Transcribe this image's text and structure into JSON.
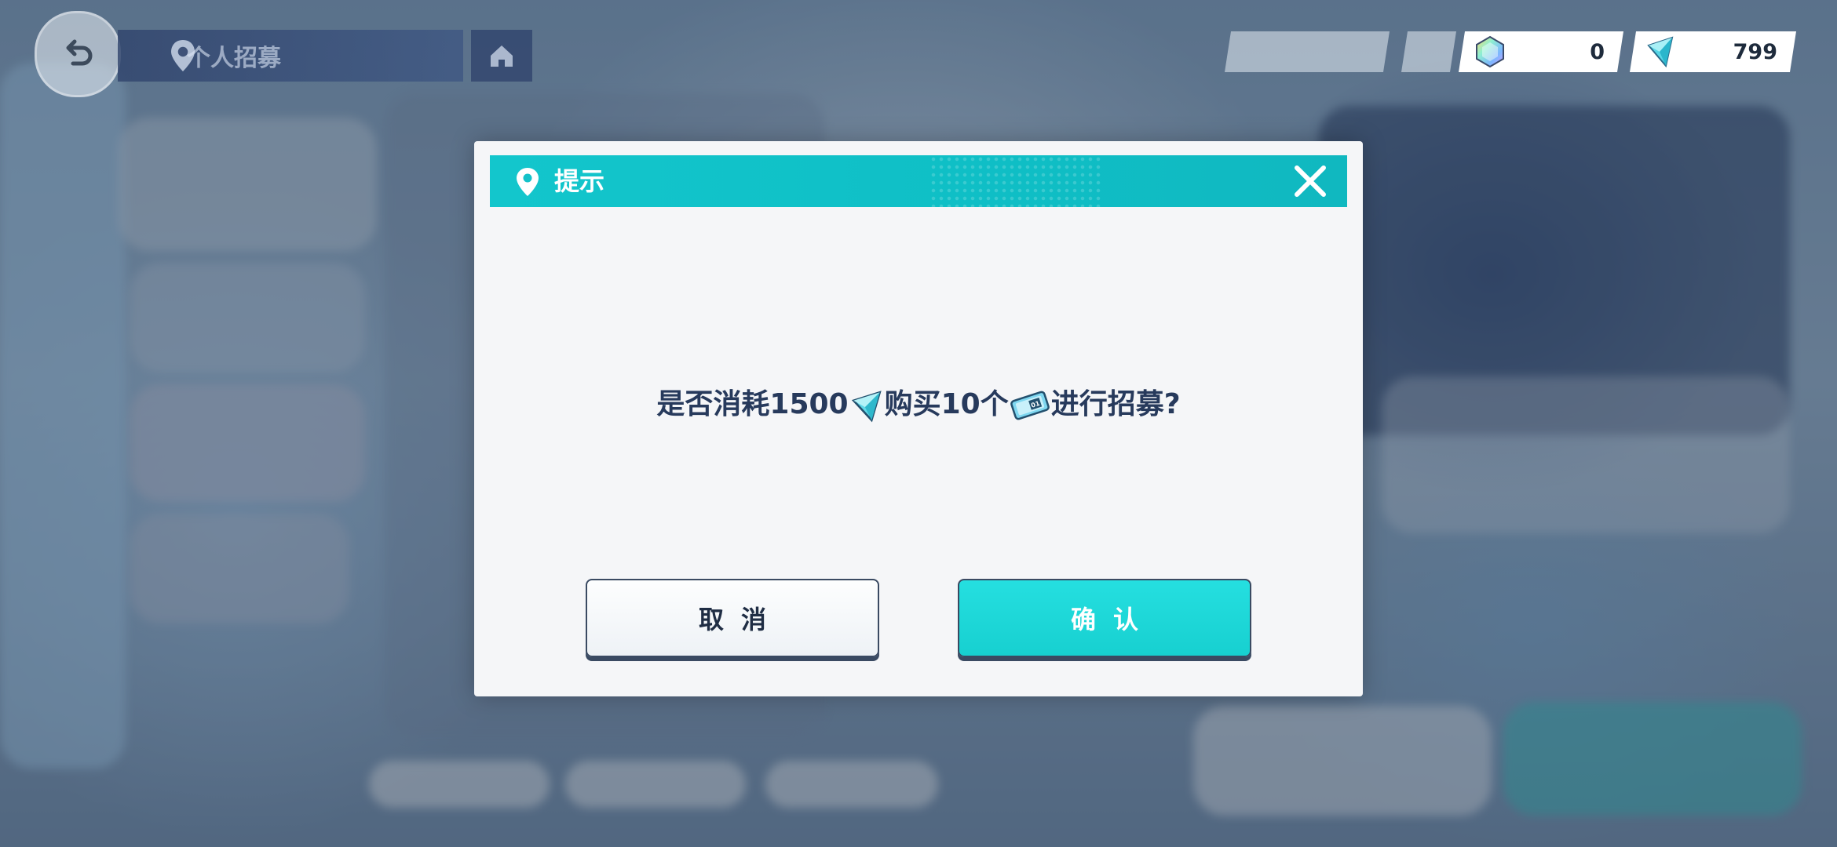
{
  "nav": {
    "title": "个人招募",
    "back_icon": "back-arrow-icon",
    "home_icon": "home-icon"
  },
  "currency": [
    {
      "icon": "crystal-gem-icon",
      "value": "0"
    },
    {
      "icon": "ticket-shard-icon",
      "value": "799"
    }
  ],
  "dialog": {
    "title": "提示",
    "title_icon": "location-pin-icon",
    "close_icon": "close-icon",
    "message_parts": {
      "prefix": "是否消耗1500",
      "middle": "购买10个",
      "suffix": "进行招募?"
    },
    "message_icons": [
      "ticket-shard-icon",
      "recruit-ticket-icon"
    ],
    "cancel_label": "取消",
    "confirm_label": "确认"
  },
  "colors": {
    "accent": "#13c6cc",
    "confirm": "#1fd6d6",
    "text_dark": "#273a5c",
    "dialog_bg": "#f5f6f8"
  }
}
